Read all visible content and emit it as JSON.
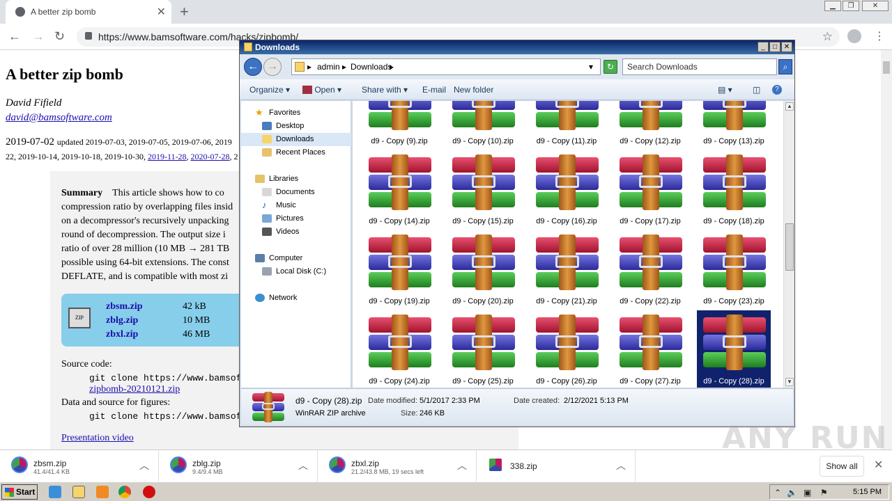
{
  "browser": {
    "tab_title": "A better zip bomb",
    "url": "https://www.bamsoftware.com/hacks/zipbomb/"
  },
  "page": {
    "title": "A better zip bomb",
    "author": "David Fifield",
    "email": "david@bamsoftware.com",
    "date_main": "2019-07-02",
    "date_updated_prefix": "updated 2019-07-03, 2019-07-05, 2019-07-06, 2019",
    "date_line2_plain": "22, 2019-10-14, 2019-10-18, 2019-10-30,",
    "date_line2_link1": "2019-11-28",
    "date_line2_link2": "2020-07-28",
    "date_line2_tail": ", 2",
    "summary_heading": "Summary",
    "summary_lines": [
      "This article shows how to co",
      "compression ratio by overlapping files insid",
      "on a decompressor's recursively unpacking",
      "round of decompression. The output size i",
      "ratio of over 28 million (10 MB → 281 TB",
      "possible using 64-bit extensions. The const",
      "DEFLATE, and is compatible with most zi"
    ],
    "downloads": [
      {
        "name": "zbsm.zip",
        "size": "42 kB"
      },
      {
        "name": "zblg.zip",
        "size": "10 MB"
      },
      {
        "name": "zbxl.zip",
        "size": "46 MB"
      }
    ],
    "source_code_label": "Source code:",
    "source_code_cmd": "git clone https://www.bamsoftwa",
    "source_code_zip": "zipbomb-20210121.zip",
    "data_source_label": "Data and source for figures:",
    "data_source_cmd": "git clone https://www.bamsoftwa",
    "presentation_video": "Presentation video"
  },
  "explorer": {
    "title": "Downloads",
    "breadcrumb": [
      "admin",
      "Downloads"
    ],
    "search_placeholder": "Search Downloads",
    "commands": {
      "organize": "Organize",
      "open": "Open",
      "share_with": "Share with",
      "email": "E-mail",
      "new_folder": "New folder"
    },
    "nav": {
      "favorites": "Favorites",
      "desktop": "Desktop",
      "downloads": "Downloads",
      "recent_places": "Recent Places",
      "libraries": "Libraries",
      "documents": "Documents",
      "music": "Music",
      "pictures": "Pictures",
      "videos": "Videos",
      "computer": "Computer",
      "local_disk": "Local Disk (C:)",
      "network": "Network"
    },
    "files": [
      "d9 - Copy (9).zip",
      "d9 - Copy (10).zip",
      "d9 - Copy (11).zip",
      "d9 - Copy (12).zip",
      "d9 - Copy (13).zip",
      "d9 - Copy (14).zip",
      "d9 - Copy (15).zip",
      "d9 - Copy (16).zip",
      "d9 - Copy (17).zip",
      "d9 - Copy (18).zip",
      "d9 - Copy (19).zip",
      "d9 - Copy (20).zip",
      "d9 - Copy (21).zip",
      "d9 - Copy (22).zip",
      "d9 - Copy (23).zip",
      "d9 - Copy (24).zip",
      "d9 - Copy (25).zip",
      "d9 - Copy (26).zip",
      "d9 - Copy (27).zip",
      "d9 - Copy (28).zip"
    ],
    "selected_index": 19,
    "details": {
      "name": "d9 - Copy (28).zip",
      "type": "WinRAR ZIP archive",
      "modified_label": "Date modified:",
      "modified": "5/1/2017 2:33 PM",
      "size_label": "Size:",
      "size": "246 KB",
      "created_label": "Date created:",
      "created": "2/12/2021 5:13 PM"
    }
  },
  "shelf": {
    "downloads": [
      {
        "name": "zbsm.zip",
        "sub": "41.4/41.4 KB"
      },
      {
        "name": "zblg.zip",
        "sub": "9.4/9.4 MB"
      },
      {
        "name": "zbxl.zip",
        "sub": "21.2/43.8 MB, 19 secs left"
      },
      {
        "name": "338.zip",
        "sub": ""
      }
    ],
    "show_all": "Show all"
  },
  "taskbar": {
    "start": "Start",
    "clock": "5:15 PM"
  },
  "watermark": "ANY RUN"
}
